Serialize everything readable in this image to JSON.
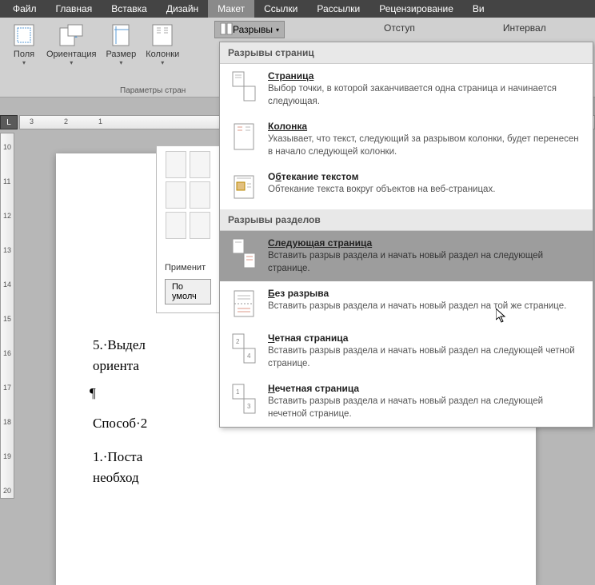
{
  "menubar": {
    "file": "Файл",
    "home": "Главная",
    "insert": "Вставка",
    "design": "Дизайн",
    "layout": "Макет",
    "references": "Ссылки",
    "mailings": "Рассылки",
    "review": "Рецензирование",
    "view": "Ви"
  },
  "ribbon": {
    "margins": "Поля",
    "orientation": "Ориентация",
    "size": "Размер",
    "columns": "Колонки",
    "breaks": "Разрывы",
    "indent": "Отступ",
    "spacing": "Интервал",
    "group_caption": "Параметры стран"
  },
  "dropdown": {
    "section1": "Разрывы страниц",
    "page_title": "Страница",
    "page_desc": "Выбор точки, в которой заканчивается одна страница и начинается следующая.",
    "column_title": "Колонка",
    "column_desc": "Указывает, что текст, следующий за разрывом колонки, будет перенесен в начало следующей колонки.",
    "textwrap_title": "Обтекание текстом",
    "textwrap_desc": "Обтекание текста вокруг объектов на веб-страницах.",
    "section2": "Разрывы разделов",
    "nextpage_title": "Следующая страница",
    "nextpage_desc": "Вставить разрыв раздела и начать новый раздел на следующей странице.",
    "continuous_title": "Без разрыва",
    "continuous_desc": "Вставить разрыв раздела и начать новый раздел на той же странице.",
    "even_title": "Четная страница",
    "even_desc": "Вставить разрыв раздела и начать новый раздел на следующей четной странице.",
    "odd_title": "Нечетная страница",
    "odd_desc": "Вставить разрыв раздела и начать новый раздел на следующей нечетной странице."
  },
  "panel": {
    "apply": "Применит",
    "default_btn": "По умолч"
  },
  "doc": {
    "line1": "5.·Выдел",
    "line2": "ориента",
    "line3": "¶",
    "line4": "Способ·2",
    "line5": "1.·Поста",
    "line6": "необход"
  },
  "hruler_marks": [
    "3",
    "2",
    "1"
  ],
  "vruler_marks": [
    "10",
    "11",
    "12",
    "13",
    "14",
    "15",
    "16",
    "17",
    "18",
    "19",
    "20"
  ],
  "corner": "L"
}
